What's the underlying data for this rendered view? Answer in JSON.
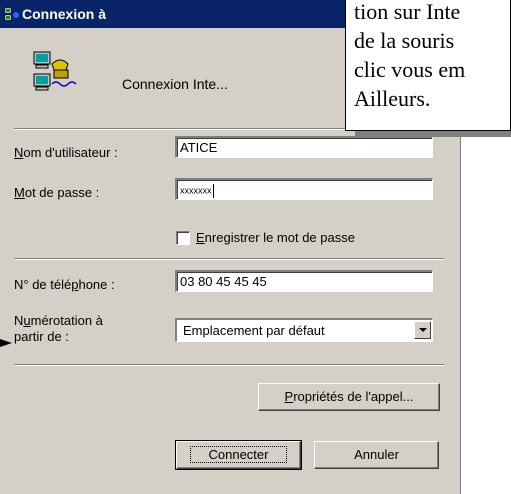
{
  "window": {
    "title": "Connexion à",
    "connection_name": "Connexion Inte..."
  },
  "form": {
    "username_label_mnemonic": "N",
    "username_label_rest": "om d'utilisateur :",
    "username_value": "ATICE",
    "password_label_mnemonic": "M",
    "password_label_rest": "ot de passe :",
    "password_value": "xxxxxxx",
    "save_password_mnemonic": "E",
    "save_password_rest": "nregistrer le mot de passe",
    "phone_label_pre": "N° de télé",
    "phone_label_mnemonic": "p",
    "phone_label_post": "hone :",
    "phone_value": "03 80 45 45 45",
    "dial_from_label_pre": "N",
    "dial_from_label_mnemonic": "u",
    "dial_from_label_post": "mérotation à",
    "dial_from_label_line2": "partir de :",
    "dial_from_value": "Emplacement par défaut"
  },
  "buttons": {
    "dial_properties_mnemonic": "P",
    "dial_properties_rest": "ropriétés de l'appel...",
    "connect": "Connecter",
    "cancel": "Annuler"
  },
  "callout": {
    "lines": [
      "tion sur Inte",
      "de la souris",
      "clic vous em",
      "Ailleurs."
    ]
  }
}
